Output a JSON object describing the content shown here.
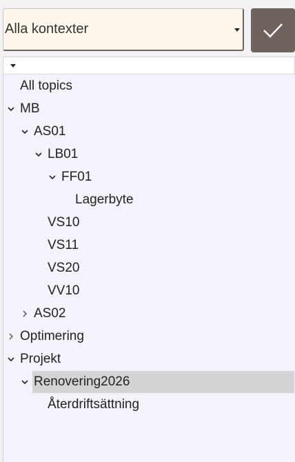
{
  "context_select": {
    "value": "Alla kontexter"
  },
  "tree": {
    "root": "All topics",
    "items": [
      {
        "label": "MB",
        "chevron": "down"
      },
      {
        "label": "AS01",
        "chevron": "down"
      },
      {
        "label": "LB01",
        "chevron": "down"
      },
      {
        "label": "FF01",
        "chevron": "down"
      },
      {
        "label": "Lagerbyte",
        "chevron": "none"
      },
      {
        "label": "VS10",
        "chevron": "none"
      },
      {
        "label": "VS11",
        "chevron": "none"
      },
      {
        "label": "VS20",
        "chevron": "none"
      },
      {
        "label": "VV10",
        "chevron": "none"
      },
      {
        "label": "AS02",
        "chevron": "right"
      },
      {
        "label": "Optimering",
        "chevron": "right"
      },
      {
        "label": "Projekt",
        "chevron": "down"
      },
      {
        "label": "Renovering2026",
        "chevron": "down",
        "selected": true
      },
      {
        "label": "Återdriftsättning",
        "chevron": "none"
      }
    ]
  },
  "colors": {
    "accent_button": "#6e625d",
    "selected_row": "#d4d4d7",
    "tree_background": "#f2f3fb"
  }
}
